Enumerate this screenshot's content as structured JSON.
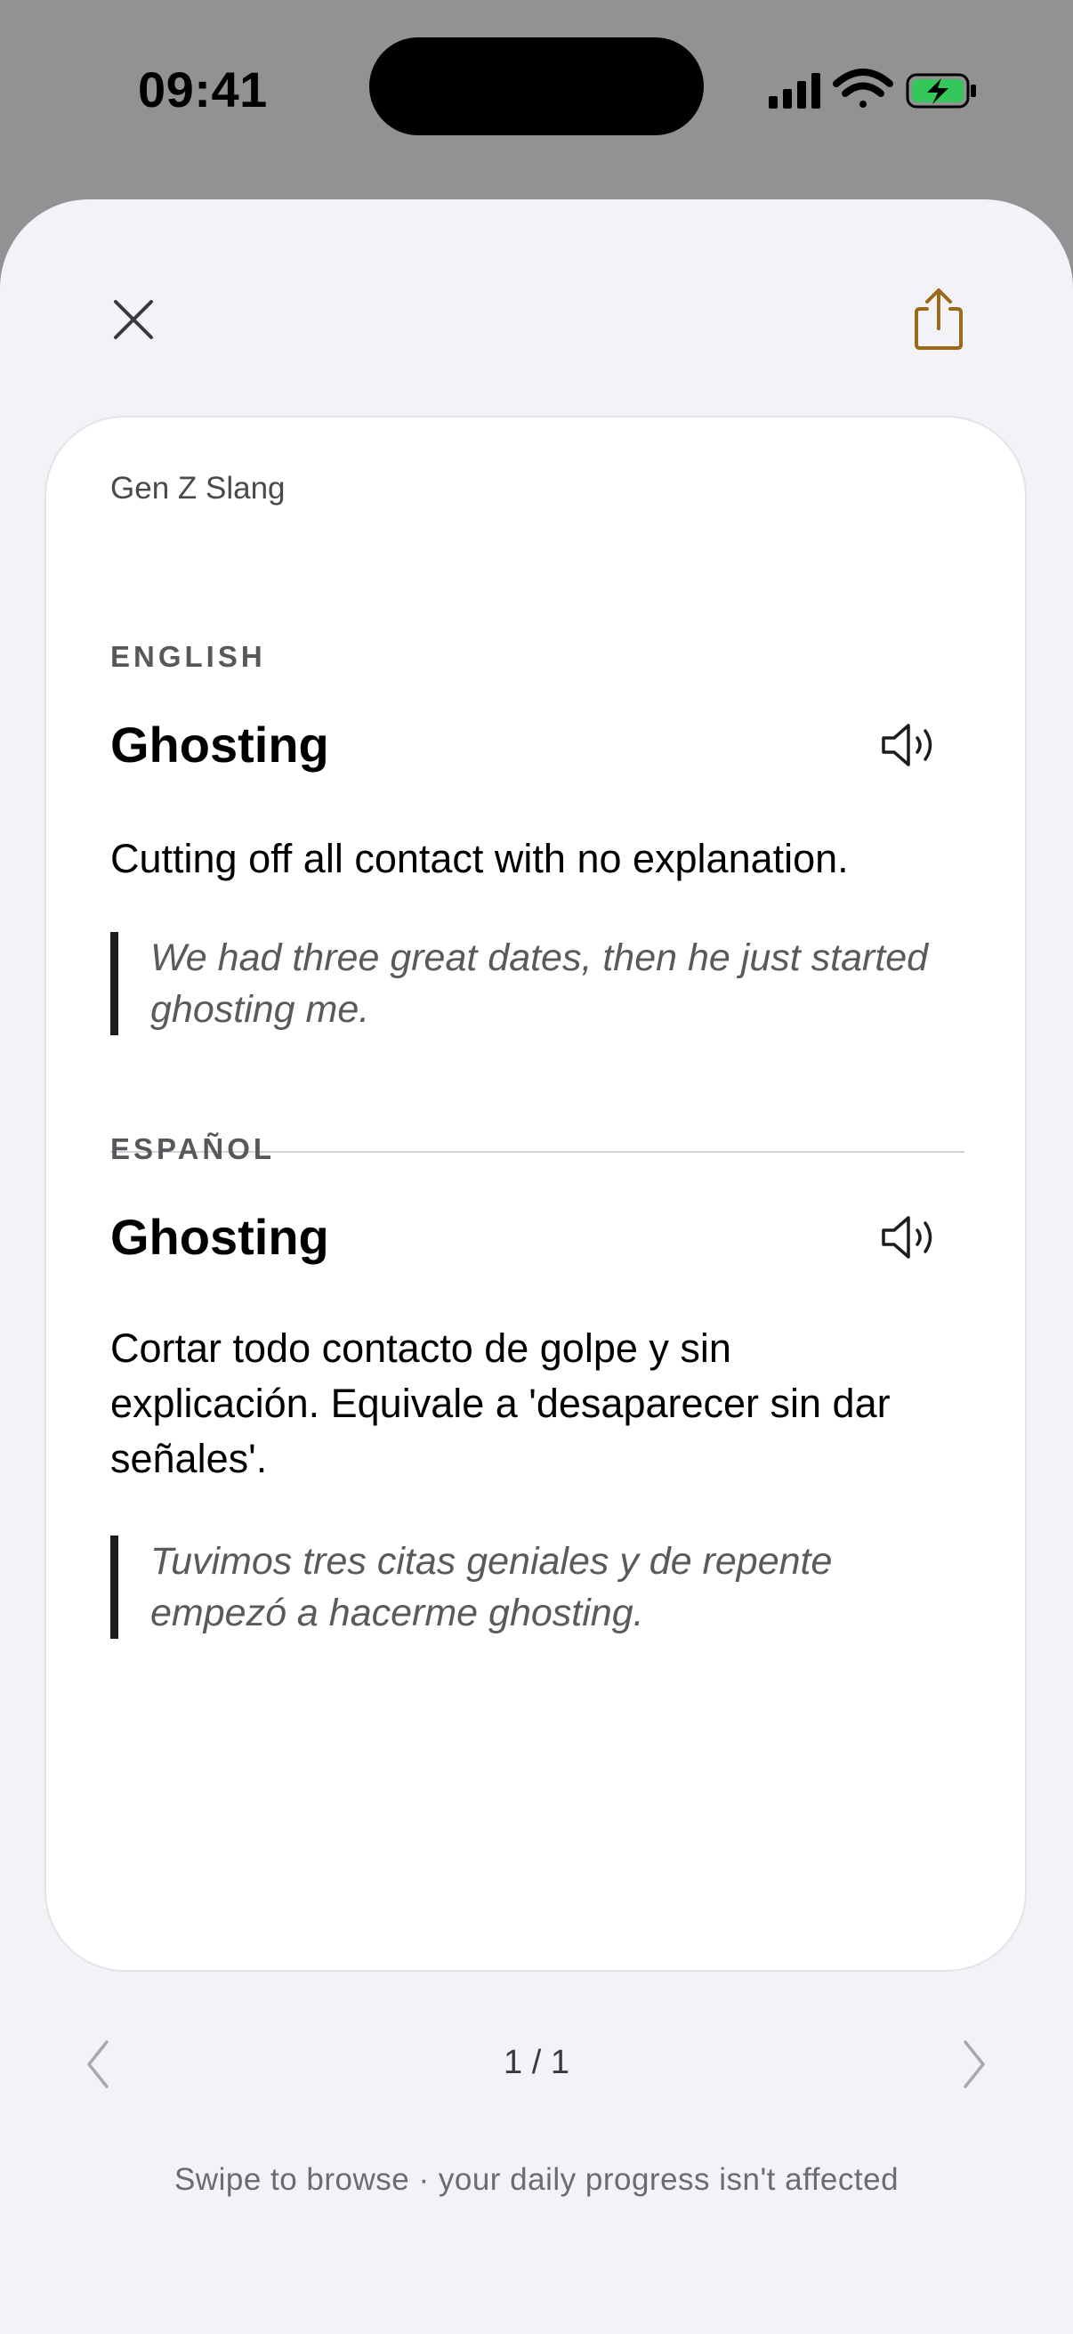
{
  "status_bar": {
    "time": "09:41",
    "battery_color": "#34c759"
  },
  "header": {
    "close_icon": "close-icon",
    "share_icon": "share-icon",
    "accent_color": "#9a6a1a"
  },
  "card": {
    "deck": "Gen Z Slang",
    "sections": [
      {
        "language": "ENGLISH",
        "term": "Ghosting",
        "definition": "Cutting off all contact with no explanation.",
        "example_line1": "We had three great dates, then he just started",
        "example_line2": "ghosting me."
      },
      {
        "language": "ESPAÑOL",
        "term": "Ghosting",
        "definition_line1": "Cortar todo contacto de golpe y sin",
        "definition_line2": "explicación. Equivale a 'desaparecer sin dar",
        "definition_line3": "señales'.",
        "example_line1": "Tuvimos tres citas geniales y de repente",
        "example_line2": "empezó a hacerme ghosting."
      }
    ]
  },
  "pager": {
    "indicator": "1 / 1"
  },
  "hint": "Swipe to browse · your daily progress isn't affected"
}
